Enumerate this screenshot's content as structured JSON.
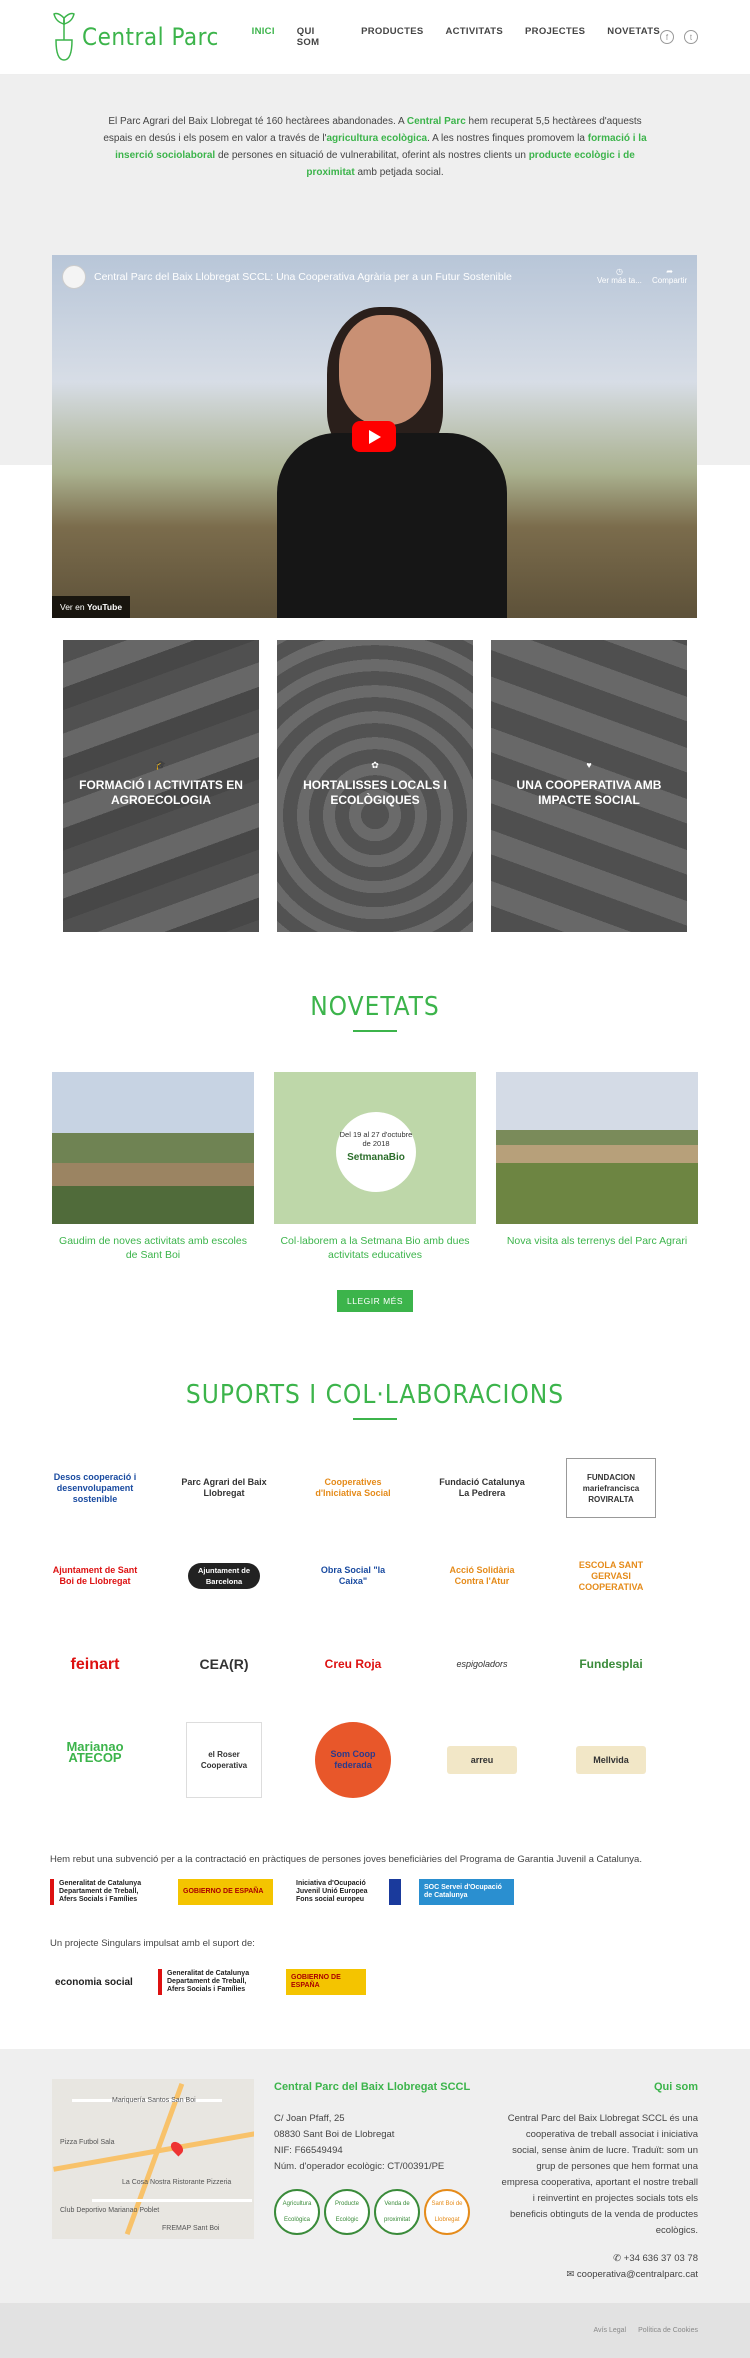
{
  "header": {
    "logo_text": "Central Parc",
    "nav": [
      "INICI",
      "QUI SOM",
      "PRODUCTES",
      "ACTIVITATS",
      "PROJECTES",
      "NOVETATS"
    ],
    "social": [
      "facebook-icon",
      "twitter-icon"
    ]
  },
  "intro": {
    "t1": "El Parc Agrari del Baix Llobregat té 160 hectàrees abandonades. A ",
    "h1": "Central Parc",
    "t2": " hem recuperat 5,5 hectàrees d'aquests espais en desús i els posem en valor a través de l'",
    "h2": "agricultura ecològica",
    "t3": ". A les nostres finques promovem la ",
    "h3": "formació i la inserció sociolaboral",
    "t4": " de persones en situació de vulnerabilitat, oferint als nostres clients un ",
    "h4": "producte ecològic i de proximitat",
    "t5": " amb petjada social."
  },
  "video": {
    "title": "Central Parc del Baix Llobregat SCCL: Una Cooperativa Agrària per a un Futur Sostenible",
    "watch_later": "Ver más ta...",
    "share": "Compartir",
    "watch_on": "Ver en",
    "youtube": "YouTube"
  },
  "cards": [
    {
      "label": "FORMACIÓ I ACTIVITATS EN AGROECOLOGIA",
      "icon": "graduation-cap-icon"
    },
    {
      "label": "HORTALISSES LOCALS I ECOLÒGIQUES",
      "icon": "leaf-icon"
    },
    {
      "label": "UNA COOPERATIVA AMB IMPACTE SOCIAL",
      "icon": "heart-icon"
    }
  ],
  "news": {
    "title": "NOVETATS",
    "items": [
      "Gaudim de noves activitats amb escoles de Sant Boi",
      "Col·laborem a la Setmana Bio amb dues activitats educatives",
      "Nova visita als terrenys del Parc Agrari"
    ],
    "poster_text": "Del 19 al 27 d'octubre de 2018",
    "poster_brand": "SetmanaBio",
    "more": "LLEGIR MÉS"
  },
  "partners": {
    "title": "SUPORTS I COL·LABORACIONS",
    "logos": [
      "Desos cooperació i desenvolupament sostenible",
      "Parc Agrari del Baix Llobregat",
      "Cooperatives d'Iniciativa Social",
      "Fundació Catalunya La Pedrera",
      "FUNDACION mariefrancisca ROVIRALTA",
      "Ajuntament de Sant Boi de Llobregat",
      "Ajuntament de Barcelona",
      "Obra Social \"la Caixa\"",
      "Acció Solidària Contra l'Atur",
      "ESCOLA SANT GERVASI COOPERATIVA",
      "feinart",
      "CEA(R)",
      "Creu Roja",
      "espigoladors",
      "Fundesplai",
      "Marianao ATECOP",
      "el Roser Cooperativa",
      "Som Coop federada",
      "arreu",
      "Mellvida"
    ],
    "note_garantia": "Hem rebut una subvenció per a la contractació en pràctiques de persones joves beneficiàries del Programa de Garantia Juvenil a Catalunya.",
    "gov1": [
      "Generalitat de Catalunya Departament de Treball, Afers Socials i Famílies",
      "GOBIERNO DE ESPAÑA",
      "Iniciativa d'Ocupació Juvenil Unió Europea Fons social europeu",
      "SOC Servei d'Ocupació de Catalunya"
    ],
    "note_singulars": "Un projecte Singulars impulsat amb el suport de:",
    "gov2": [
      "economia social",
      "Generalitat de Catalunya Departament de Treball, Afers Socials i Famílies",
      "GOBIERNO DE ESPAÑA"
    ]
  },
  "footer": {
    "company": "Central Parc del Baix Llobregat SCCL",
    "address": "C/ Joan Pfaff, 25",
    "city": "08830 Sant Boi de Llobregat",
    "nif": "NIF: F66549494",
    "operator": "Núm. d'operador ecològic: CT/00391/PE",
    "badges": [
      "Agricultura Ecològica",
      "Producte Ecològic",
      "Venda de proximitat",
      "Sant Boi de Llobregat"
    ],
    "map_labels": [
      "Mariquería Santos San Boi",
      "Pizza Futbol Sala",
      "La Cosa Nostra Ristorante Pizzeria",
      "Club Deportivo Marianao Poblet",
      "FREMAP Sant Boi"
    ],
    "qui_title": "Qui som",
    "qui_text": "Central Parc del Baix Llobregat SCCL és una cooperativa de treball associat i iniciativa social, sense ànim de lucre. Traduït: som un grup de persones que hem format una empresa cooperativa, aportant el nostre treball i reinvertint en projectes socials tots els beneficis obtinguts de la venda de productes ecològics.",
    "phone": "+34 636 37 03 78",
    "email": "cooperativa@centralparc.cat"
  },
  "bottom": [
    "Avís Legal",
    "Política de Cookies"
  ]
}
